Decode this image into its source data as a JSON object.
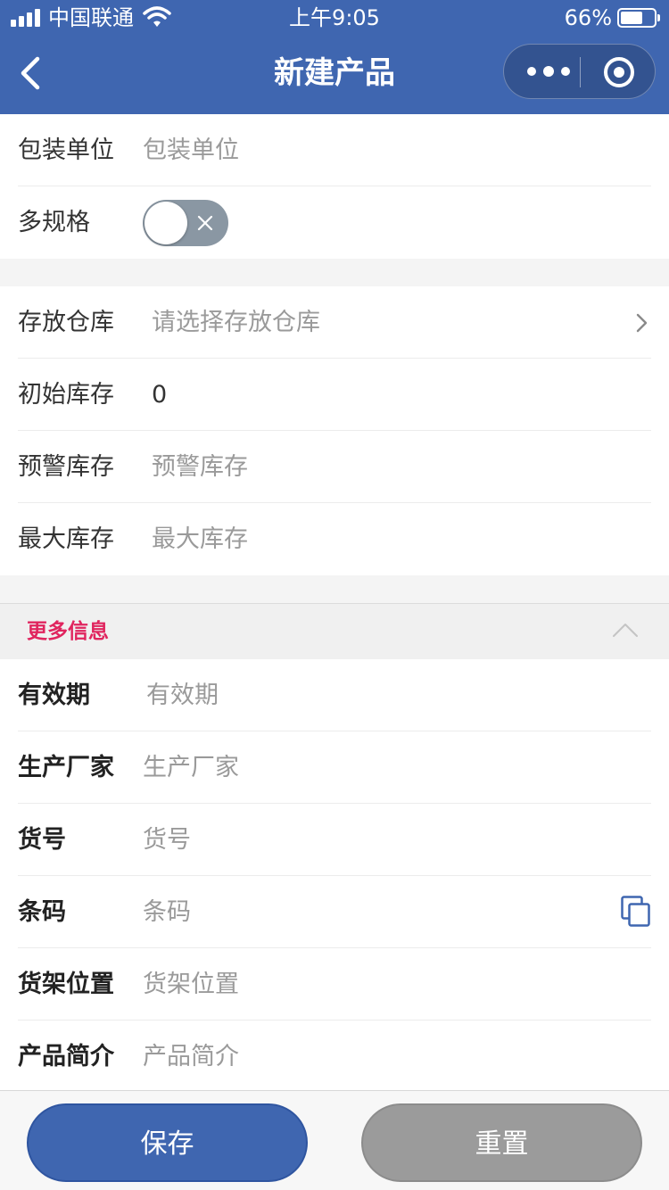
{
  "status_bar": {
    "carrier": "中国联通",
    "time": "上午9:05",
    "battery": "66%",
    "battery_level": 0.66
  },
  "nav": {
    "title": "新建产品",
    "back_icon": "chevron-left-icon",
    "more_icon": "more-dots-icon",
    "close_icon": "target-icon"
  },
  "basic": {
    "packaging_unit": {
      "label": "包装单位",
      "placeholder": "包装单位"
    },
    "multi_spec": {
      "label": "多规格",
      "enabled": false
    }
  },
  "inventory": {
    "warehouse": {
      "label": "存放仓库",
      "placeholder": "请选择存放仓库"
    },
    "initial_stock": {
      "label": "初始库存",
      "value": "0"
    },
    "warning_stock": {
      "label": "预警库存",
      "placeholder": "预警库存"
    },
    "max_stock": {
      "label": "最大库存",
      "placeholder": "最大库存"
    }
  },
  "more_info": {
    "title": "更多信息",
    "expanded": true,
    "fields": [
      {
        "label": "有效期",
        "placeholder": "有效期"
      },
      {
        "label": "生产厂家",
        "placeholder": "生产厂家"
      },
      {
        "label": "货号",
        "placeholder": "货号"
      },
      {
        "label": "条码",
        "placeholder": "条码"
      },
      {
        "label": "货架位置",
        "placeholder": "货架位置"
      },
      {
        "label": "产品简介",
        "placeholder": "产品简介"
      }
    ]
  },
  "actions": {
    "save": "保存",
    "reset": "重置"
  },
  "colors": {
    "primary": "#3f66b0",
    "accent": "#e0245e",
    "disabled": "#9b9b9b"
  }
}
